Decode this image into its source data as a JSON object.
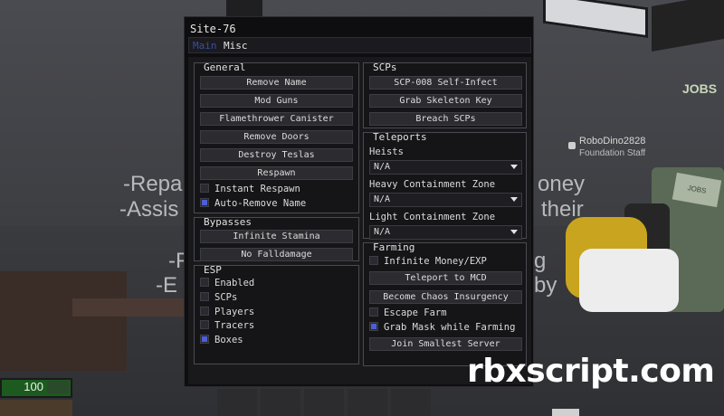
{
  "background": {
    "sign_lines": [
      "-Repa",
      "-Assis",
      "-F",
      "-E",
      "oney",
      "their",
      "g",
      "by"
    ],
    "jobs_sign": "JOBS",
    "terminal_label": "JOBS",
    "npc_name": "RoboDino2828",
    "npc_role": "Foundation Staff",
    "health_value": "100"
  },
  "watermark": "rbxscript.com",
  "gui": {
    "title": "Site-76",
    "tabs": [
      {
        "label": "Main",
        "active": true
      },
      {
        "label": "Misc",
        "active": false
      }
    ],
    "accent_color": "#4b5fd6",
    "general": {
      "title": "General",
      "buttons": [
        "Remove Name",
        "Mod Guns",
        "Flamethrower Canister",
        "Remove Doors",
        "Destroy Teslas",
        "Respawn"
      ],
      "toggles": [
        {
          "label": "Instant Respawn",
          "checked": false
        },
        {
          "label": "Auto-Remove Name",
          "checked": true
        }
      ]
    },
    "bypasses": {
      "title": "Bypasses",
      "buttons": [
        "Infinite Stamina",
        "No Falldamage"
      ]
    },
    "esp": {
      "title": "ESP",
      "toggles": [
        {
          "label": "Enabled",
          "checked": false
        },
        {
          "label": "SCPs",
          "checked": false
        },
        {
          "label": "Players",
          "checked": false
        },
        {
          "label": "Tracers",
          "checked": false
        },
        {
          "label": "Boxes",
          "checked": true
        }
      ]
    },
    "scps": {
      "title": "SCPs",
      "buttons": [
        "SCP-008 Self-Infect",
        "Grab Skeleton Key",
        "Breach SCPs"
      ]
    },
    "teleports": {
      "title": "Teleports",
      "dropdowns": [
        {
          "label": "Heists",
          "value": "N/A"
        },
        {
          "label": "Heavy Containment Zone",
          "value": "N/A"
        },
        {
          "label": "Light Containment Zone",
          "value": "N/A"
        }
      ]
    },
    "farming": {
      "title": "Farming",
      "items": [
        {
          "kind": "toggle",
          "label": "Infinite Money/EXP",
          "checked": false
        },
        {
          "kind": "button",
          "label": "Teleport to MCD"
        },
        {
          "kind": "button",
          "label": "Become Chaos Insurgency"
        },
        {
          "kind": "toggle",
          "label": "Escape Farm",
          "checked": false
        },
        {
          "kind": "toggle",
          "label": "Grab Mask while Farming",
          "checked": true
        },
        {
          "kind": "button",
          "label": "Join Smallest Server"
        }
      ]
    }
  }
}
